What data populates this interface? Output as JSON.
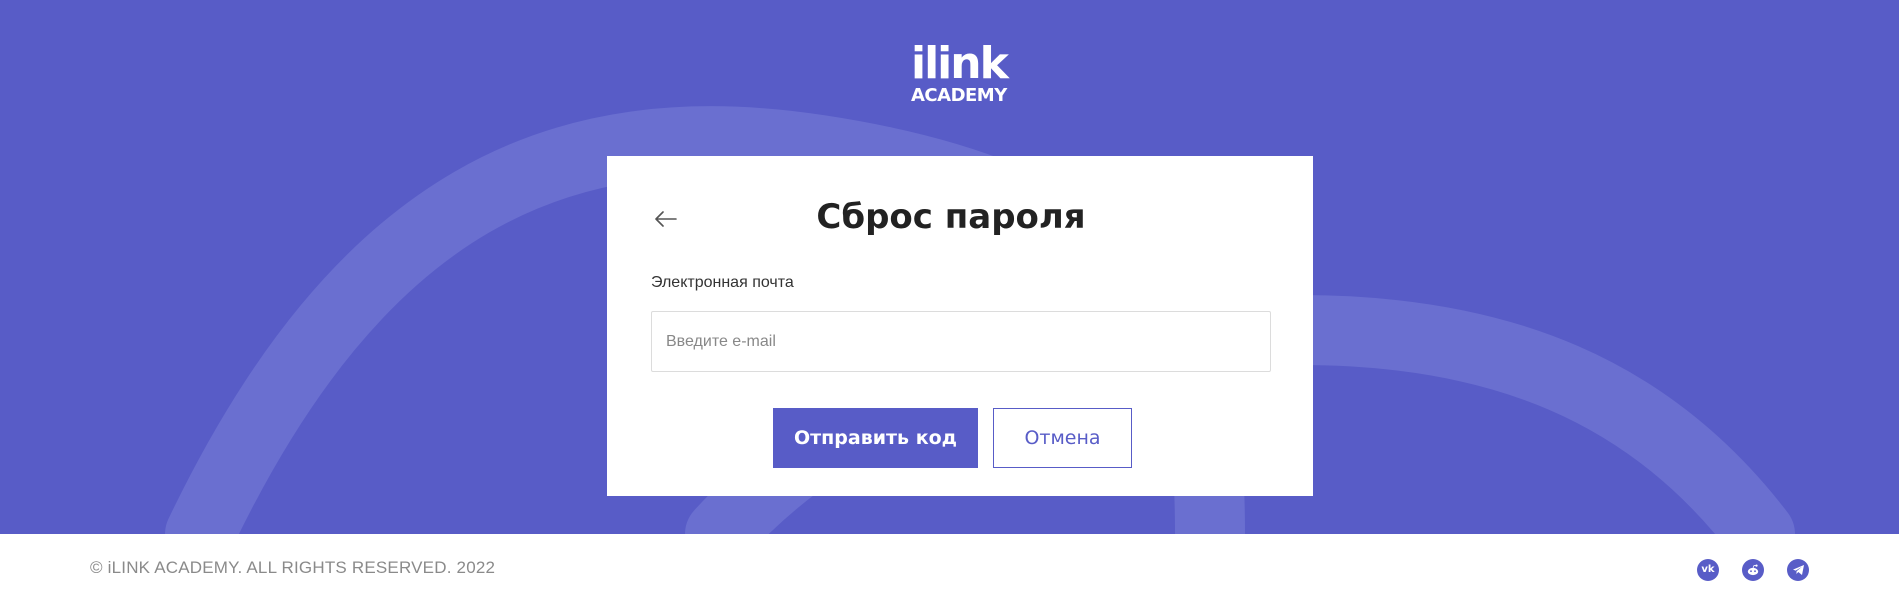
{
  "colors": {
    "brand": "#585cc7",
    "background": "#ffffff",
    "text_dark": "#222222",
    "muted": "#8a8a8a"
  },
  "header": {
    "logo_top": "ilink",
    "logo_bottom": "ACADEMY"
  },
  "reset_form": {
    "title": "Сброс пароля",
    "back_icon": "arrow-left-icon",
    "email_label": "Электронная почта",
    "email_value": "",
    "email_placeholder": "Введите e-mail",
    "submit_label": "Отправить код",
    "cancel_label": "Отмена"
  },
  "footer": {
    "copyright": "© iLINK ACADEMY. ALL RIGHTS RESERVED. 2022",
    "social_icons": [
      "vk-icon",
      "reddit-icon",
      "telegram-icon"
    ]
  }
}
